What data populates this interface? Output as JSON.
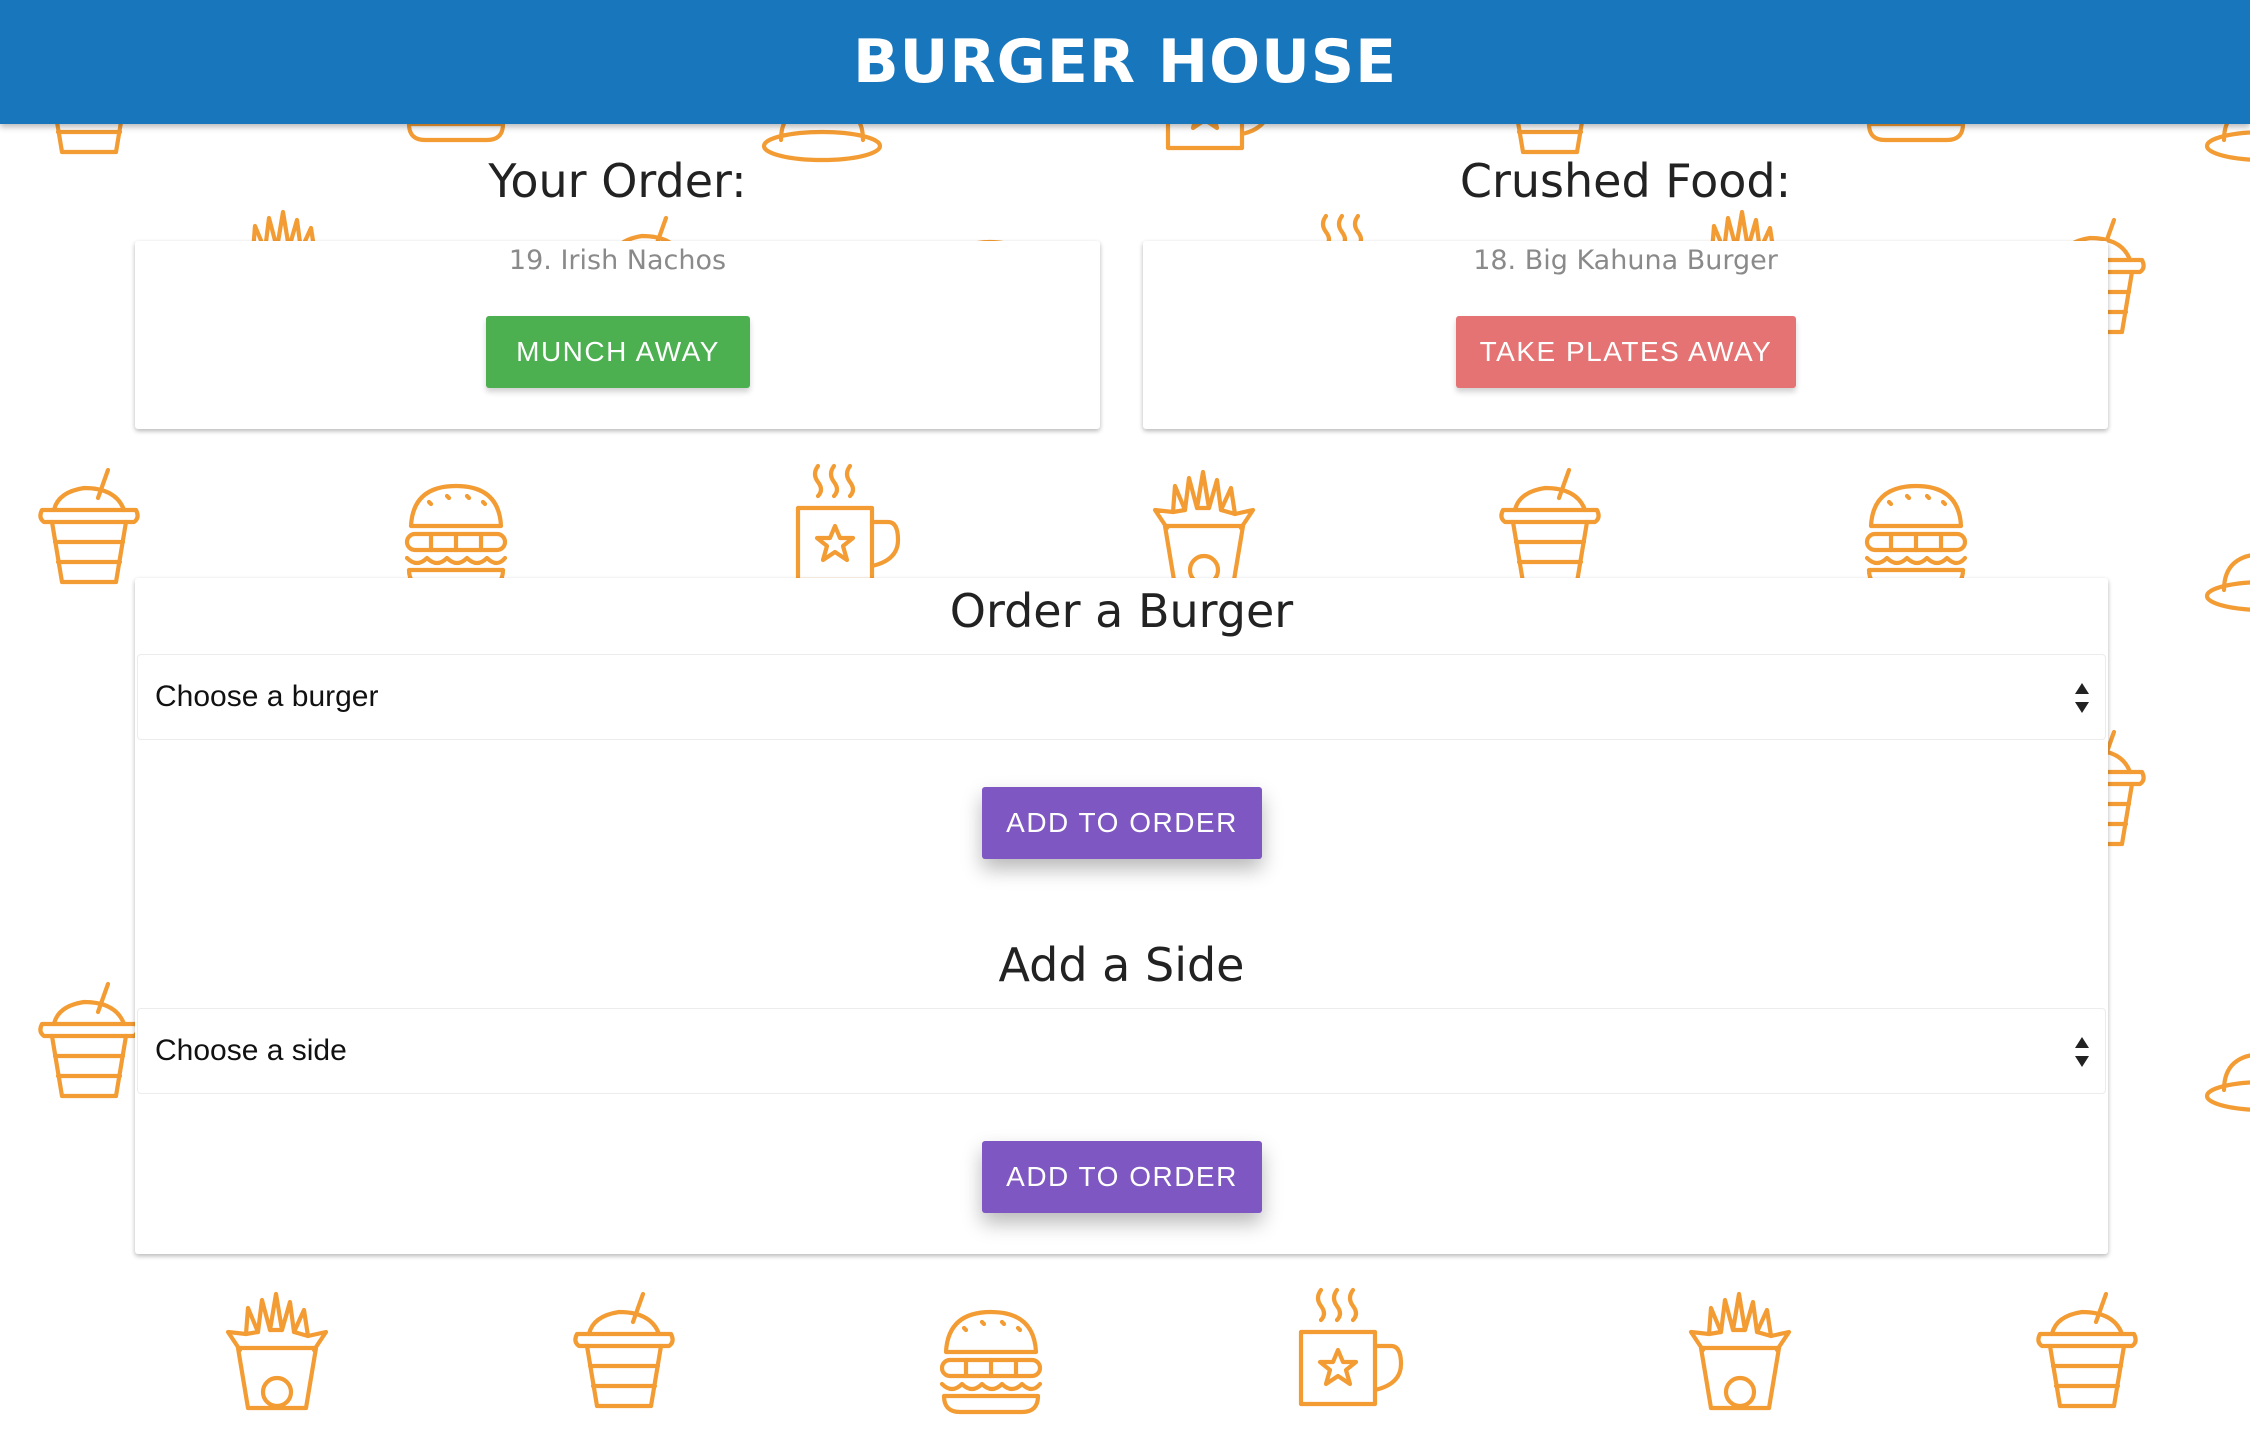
{
  "navbar": {
    "brand": "BURGER HOUSE"
  },
  "your_order": {
    "title": "Your Order:",
    "item": "19. Irish Nachos",
    "button_label": "MUNCH AWAY"
  },
  "crushed_food": {
    "title": "Crushed Food:",
    "item": "18. Big Kahuna Burger",
    "button_label": "TAKE PLATES AWAY"
  },
  "order_burger": {
    "title": "Order a Burger",
    "select_value": "Choose a burger",
    "button_label": "ADD TO ORDER"
  },
  "add_side": {
    "title": "Add a Side",
    "select_value": "Choose a side",
    "button_label": "ADD TO ORDER"
  },
  "theme": {
    "navbar_color": "#1776bc",
    "pattern_color": "#f39c34",
    "munch_button_color": "#4caf50",
    "take_plates_button_color": "#e57373",
    "add_button_color": "#7e57c2"
  },
  "background_pattern": {
    "icons": [
      "fries-icon",
      "drink-icon",
      "burger-icon",
      "coffee-cup-icon",
      "plate-icon"
    ]
  }
}
